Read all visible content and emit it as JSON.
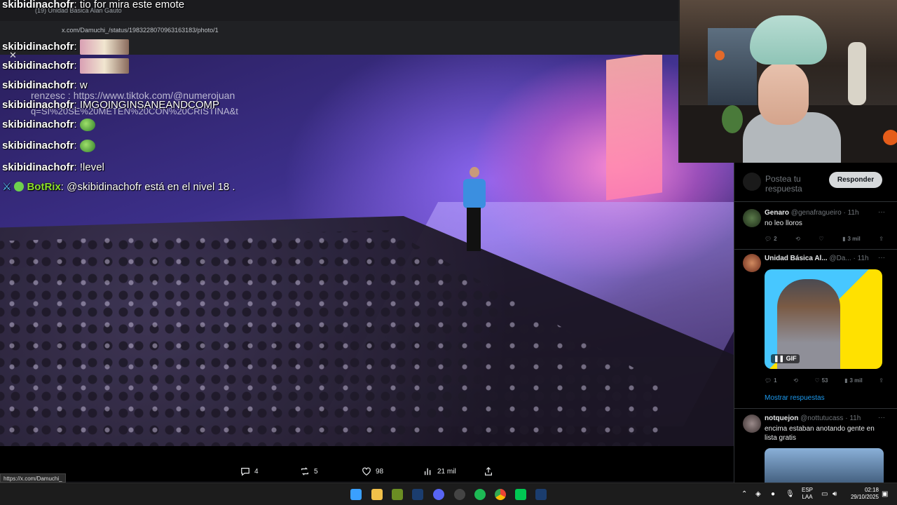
{
  "browser": {
    "url": "x.com/Damuchi_/status/1983228070963163183/photo/1",
    "ghost_tab": "(19) Unidad Básica Alan Gauto",
    "status_url": "https://x.com/Damuchi_"
  },
  "chat": {
    "lines": [
      {
        "user": "skibidinachofr",
        "msg": "tio for mira este emote"
      },
      {
        "user": "skibidinachofr",
        "msg": ""
      },
      {
        "user": "skibidinachofr",
        "msg": ""
      },
      {
        "user": "skibidinachofr",
        "msg": "w"
      },
      {
        "user": "skibidinachofr",
        "msg": "IMGOINGINSANEANDCOMP"
      },
      {
        "user": "skibidinachofr",
        "msg": ""
      },
      {
        "user": "skibidinachofr",
        "msg": ""
      },
      {
        "user": "skibidinachofr",
        "msg": "!level"
      },
      {
        "user": "BotRix",
        "msg": "@skibidinachofr está en el nivel 18 ."
      }
    ],
    "ghost_user": "renzesc",
    "ghost_link": "https://www.tiktok.com/@numerojuan",
    "ghost_query": "q=SI%20SE%20METEN%20CON%20CRISTINA&t"
  },
  "post_actions": {
    "replies": "4",
    "reposts": "5",
    "likes": "98",
    "views": "21 mil"
  },
  "replies_panel": {
    "compose_placeholder": "Postea tu respuesta",
    "reply_button": "Responder",
    "replies": [
      {
        "name": "Genaro",
        "handle": "@genafragueiro",
        "time": "11h",
        "text": "no leo lloros",
        "stats": [
          "2",
          "",
          "",
          "3 mil"
        ]
      },
      {
        "name": "Unidad Básica Al...",
        "handle": "@Da...",
        "time": "11h",
        "text": "",
        "media": "GIF",
        "stats": [
          "1",
          "",
          "53",
          "3 mil"
        ]
      },
      {
        "name": "notquejon",
        "handle": "@nottutucass",
        "time": "11h",
        "text": "encima estaban anotando gente en lista gratis",
        "stats": []
      }
    ],
    "show_more": "Mostrar respuestas"
  },
  "taskbar": {
    "lang": "ESP",
    "lang2": "LAA",
    "time": "02:18",
    "date": "29/10/2025"
  },
  "colors": {
    "bot_name": "#8be02a",
    "link_blue": "#1d9bf0",
    "panel_bg": "#000000"
  }
}
